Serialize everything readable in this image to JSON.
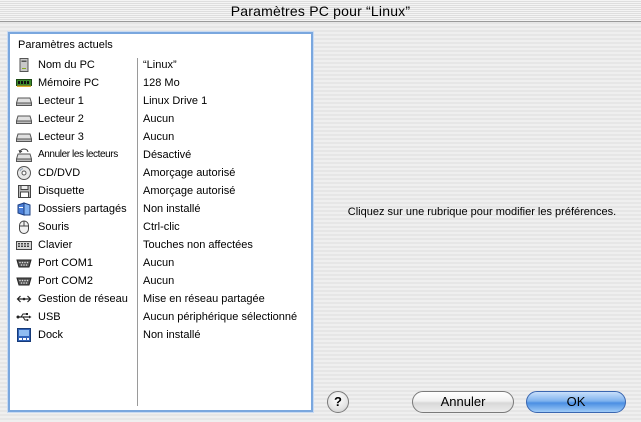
{
  "window": {
    "title": "Paramètres PC pour “Linux”"
  },
  "panel": {
    "header": "Paramètres actuels",
    "rows": [
      {
        "icon": "pc-tower-icon",
        "label": "Nom du PC",
        "value": "“Linux”"
      },
      {
        "icon": "memory-chip-icon",
        "label": "Mémoire PC",
        "value": "128 Mo"
      },
      {
        "icon": "drive-icon",
        "label": "Lecteur 1",
        "value": "Linux Drive 1"
      },
      {
        "icon": "drive-icon",
        "label": "Lecteur 2",
        "value": "Aucun"
      },
      {
        "icon": "drive-icon",
        "label": "Lecteur 3",
        "value": "Aucun"
      },
      {
        "icon": "undo-drives-icon",
        "label": "Annuler les lecteurs",
        "value": "Désactivé"
      },
      {
        "icon": "cd-icon",
        "label": "CD/DVD",
        "value": "Amorçage autorisé"
      },
      {
        "icon": "floppy-icon",
        "label": "Disquette",
        "value": "Amorçage autorisé"
      },
      {
        "icon": "shared-folder-icon",
        "label": "Dossiers partagés",
        "value": "Non installé"
      },
      {
        "icon": "mouse-icon",
        "label": "Souris",
        "value": "Ctrl-clic"
      },
      {
        "icon": "keyboard-icon",
        "label": "Clavier",
        "value": "Touches non affectées"
      },
      {
        "icon": "serial-port-icon",
        "label": "Port COM1",
        "value": "Aucun"
      },
      {
        "icon": "serial-port-icon",
        "label": "Port COM2",
        "value": "Aucun"
      },
      {
        "icon": "network-icon",
        "label": "Gestion de réseau",
        "value": "Mise en réseau partagée"
      },
      {
        "icon": "usb-icon",
        "label": "USB",
        "value": "Aucun périphérique sélectionné"
      },
      {
        "icon": "dock-icon",
        "label": "Dock",
        "value": "Non installé"
      }
    ]
  },
  "hint": "Cliquez sur une rubrique pour modifier les préférences.",
  "buttons": {
    "help": "?",
    "cancel": "Annuler",
    "ok": "OK"
  }
}
